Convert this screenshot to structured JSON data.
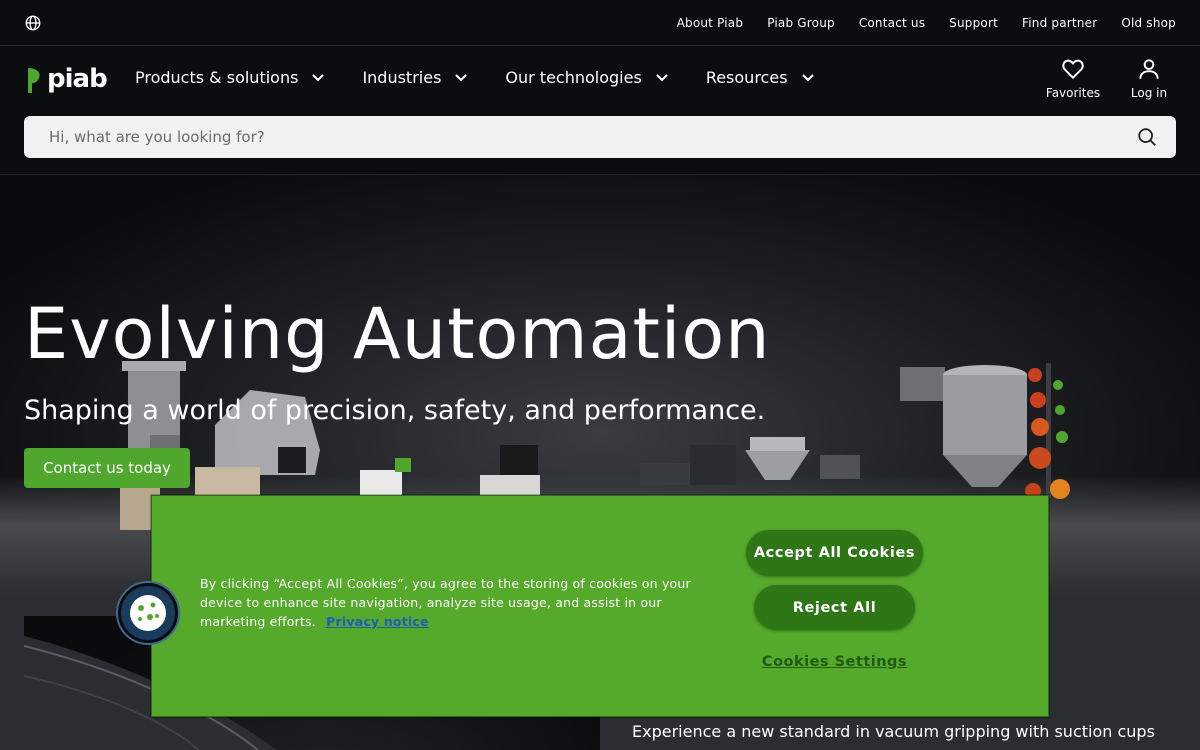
{
  "topbar": {
    "links": [
      "About Piab",
      "Piab Group",
      "Contact us",
      "Support",
      "Find partner",
      "Old shop"
    ]
  },
  "header": {
    "logo_text": "piab",
    "nav": [
      "Products & solutions",
      "Industries",
      "Our technologies",
      "Resources"
    ],
    "favorites_label": "Favorites",
    "login_label": "Log in",
    "search_placeholder": "Hi, what are you looking for?"
  },
  "hero": {
    "title": "Evolving Automation",
    "subtitle": "Shaping a world of precision, safety, and performance.",
    "cta": "Contact us today"
  },
  "lower": {
    "text": "Experience a new standard in vacuum gripping with suction cups"
  },
  "cookie": {
    "text": "By clicking “Accept All Cookies”, you agree to the storing of cookies on your device to enhance site navigation, analyze site usage, and assist in our marketing efforts.",
    "privacy_link": "Privacy notice",
    "accept": "Accept All Cookies",
    "reject": "Reject All",
    "settings": "Cookies Settings"
  },
  "colors": {
    "brand_green": "#4fa82d",
    "cookie_bg": "#56aa2b",
    "button_dark_green": "#2f7616",
    "header_bg": "#0c0d0f"
  },
  "icons": [
    "globe-icon",
    "piab-logo-icon",
    "chevron-down-icon",
    "heart-icon",
    "user-icon",
    "search-icon",
    "cookie-icon"
  ]
}
